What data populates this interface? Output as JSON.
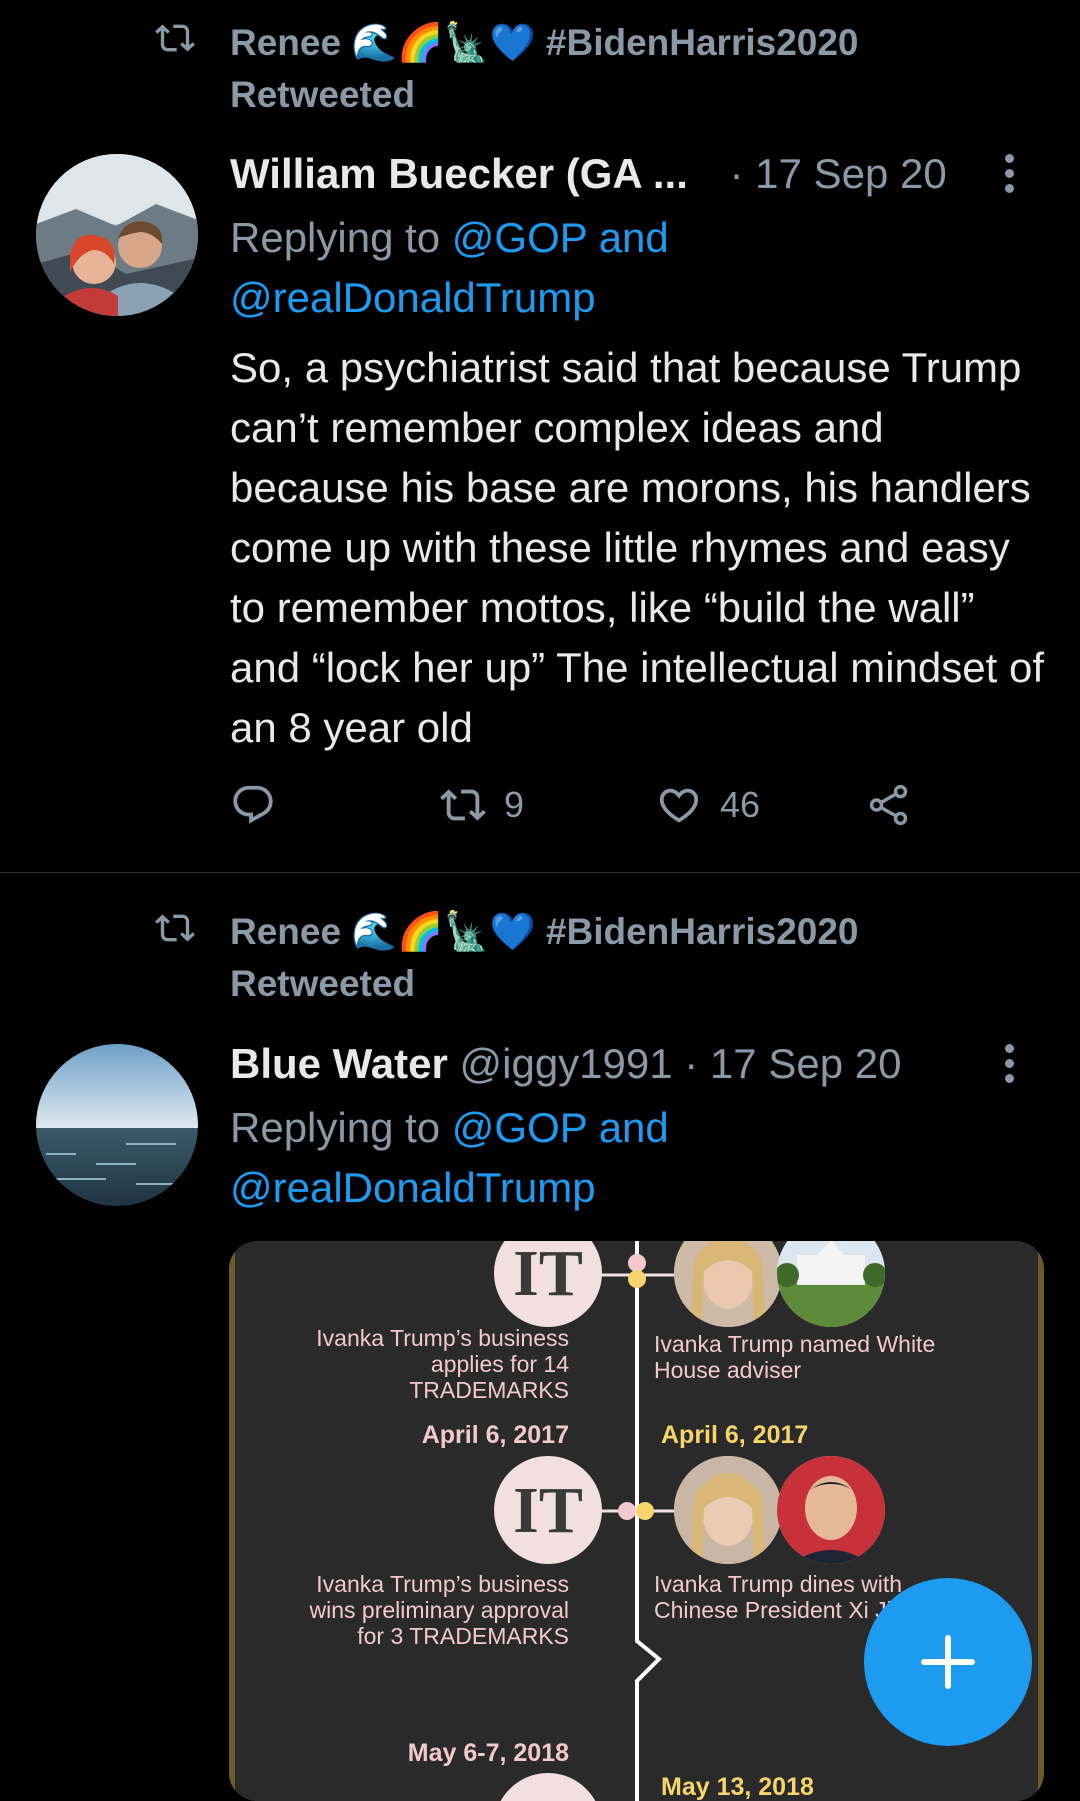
{
  "tweets": [
    {
      "retweeted_by": "Renee 🌊🌈🗽💙 #BidenHarris2020",
      "retweeted_label": "Retweeted",
      "author_name": "William Buecker (GA ...",
      "author_handle": "",
      "date": "· 17 Sep 20",
      "replying_prefix": "Replying to",
      "replying_to": "@GOP and @realDonaldTrump",
      "body": "So, a psychiatrist said that because Trump can’t remember complex ideas and because his base are morons, his handlers come up with these little rhymes and easy to remember mottos, like “build the wall” and “lock her up” The intellectual mindset of an 8 year old",
      "retweets": "9",
      "likes": "46"
    },
    {
      "retweeted_by": "Renee 🌊🌈🗽💙 #BidenHarris2020",
      "retweeted_label": "Retweeted",
      "author_name": "Blue Water",
      "author_handle": "@iggy1991",
      "date": "· 17 Sep 20",
      "replying_prefix": "Replying to",
      "replying_to": "@GOP and @realDonaldTrump",
      "media": {
        "left_text_1": "Ivanka Trump’s business applies for 14 TRADEMARKS",
        "right_text_1": "Ivanka Trump named White House adviser",
        "left_date_2": "April 6, 2017",
        "right_date_2": "April 6, 2017",
        "left_text_2": "Ivanka Trump’s business wins preliminary approval for 3 TRADEMARKS",
        "right_text_2": "Ivanka Trump dines with Chinese President Xi Jinping",
        "left_date_3": "May 6-7, 2018",
        "right_date_3": "May 13, 2018",
        "logo_letters": "IT"
      }
    }
  ],
  "fab": {
    "icon": "plus-icon"
  },
  "icons": [
    "retweet-icon",
    "more-icon",
    "reply-icon",
    "like-icon",
    "share-icon"
  ],
  "colors": {
    "accent": "#1d9bf0",
    "muted": "#8b98a5",
    "background": "#000000"
  }
}
